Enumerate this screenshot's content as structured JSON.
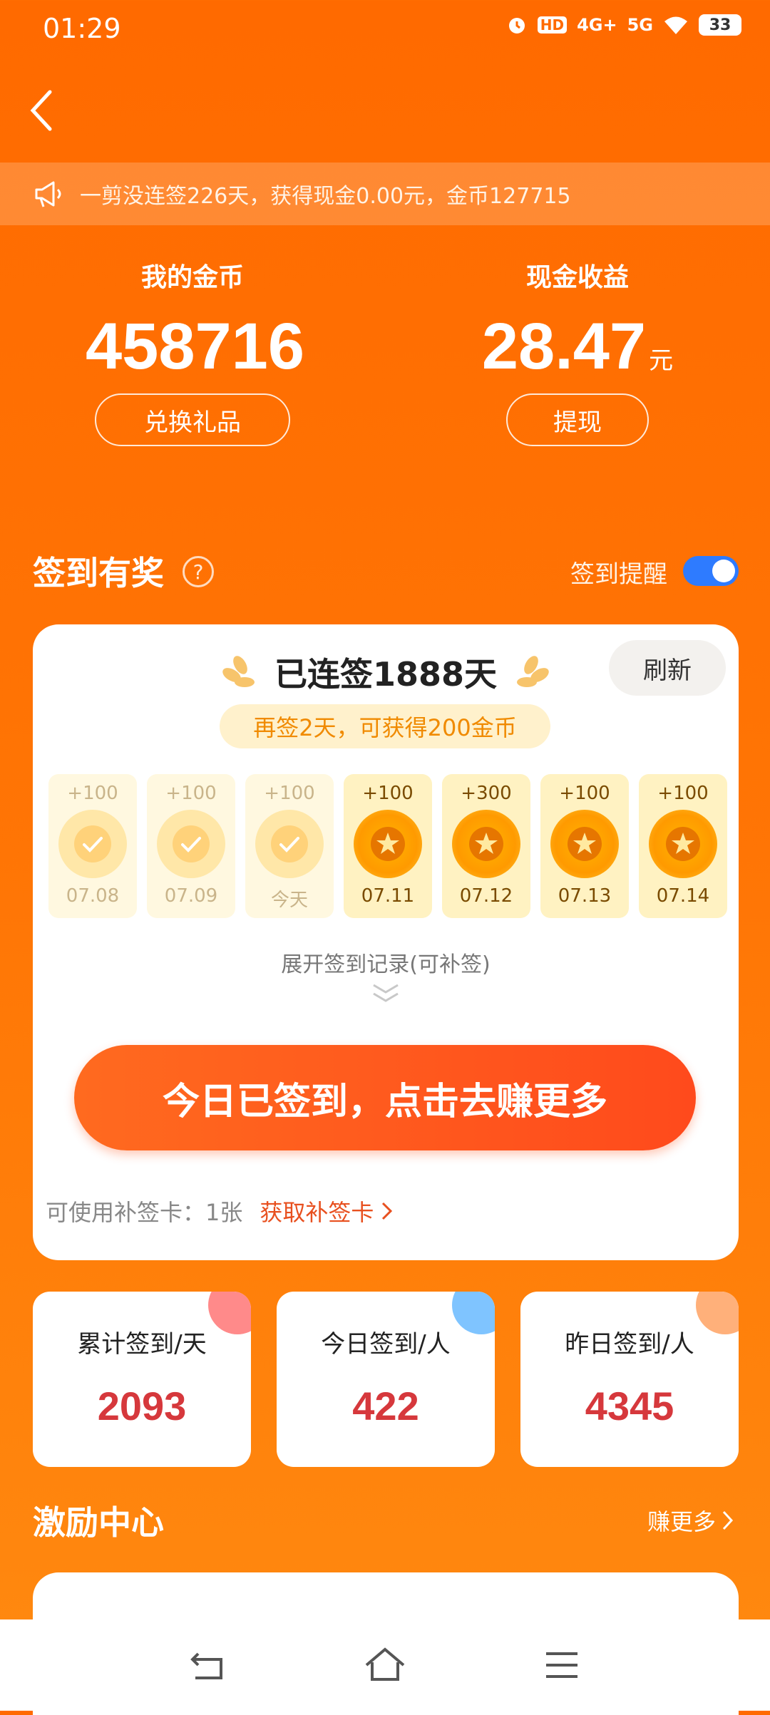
{
  "status_bar": {
    "time": "01:29",
    "hd": "HD",
    "net1": "4G+",
    "net2": "5G",
    "battery": "33"
  },
  "notice": {
    "text": "一剪没连签226天，获得现金0.00元，金币127715"
  },
  "stats": {
    "coins_label": "我的金币",
    "coins_value": "458716",
    "exchange_label": "兑换礼品",
    "cash_label": "现金收益",
    "cash_value": "28.47",
    "cash_unit": "元",
    "withdraw_label": "提现"
  },
  "signin": {
    "title": "签到有奖",
    "help": "?",
    "reminder_label": "签到提醒",
    "reminder_on": true,
    "streak_text": "已连签1888天",
    "refresh_label": "刷新",
    "hint": "再签2天，可获得200金币",
    "days": [
      {
        "points": "+100",
        "date": "07.08",
        "signed": true
      },
      {
        "points": "+100",
        "date": "07.09",
        "signed": true
      },
      {
        "points": "+100",
        "date": "今天",
        "signed": true
      },
      {
        "points": "+100",
        "date": "07.11",
        "signed": false
      },
      {
        "points": "+300",
        "date": "07.12",
        "signed": false
      },
      {
        "points": "+100",
        "date": "07.13",
        "signed": false
      },
      {
        "points": "+100",
        "date": "07.14",
        "signed": false
      }
    ],
    "expand_label": "展开签到记录(可补签)",
    "main_button": "今日已签到，点击去赚更多",
    "makeup_cards": "可使用补签卡：1张",
    "makeup_link": "获取补签卡"
  },
  "summary": [
    {
      "label": "累计签到/天",
      "value": "2093",
      "accent": "#FF8A8A"
    },
    {
      "label": "今日签到/人",
      "value": "422",
      "accent": "#7FC4FF"
    },
    {
      "label": "昨日签到/人",
      "value": "4345",
      "accent": "#FFB07A"
    }
  ],
  "incentive": {
    "title": "激励中心",
    "more_label": "赚更多"
  },
  "colors": {
    "brand": "#FF6A00",
    "button": "#FF4A1C",
    "value_red": "#D6383C",
    "toggle": "#2E7BFF"
  }
}
